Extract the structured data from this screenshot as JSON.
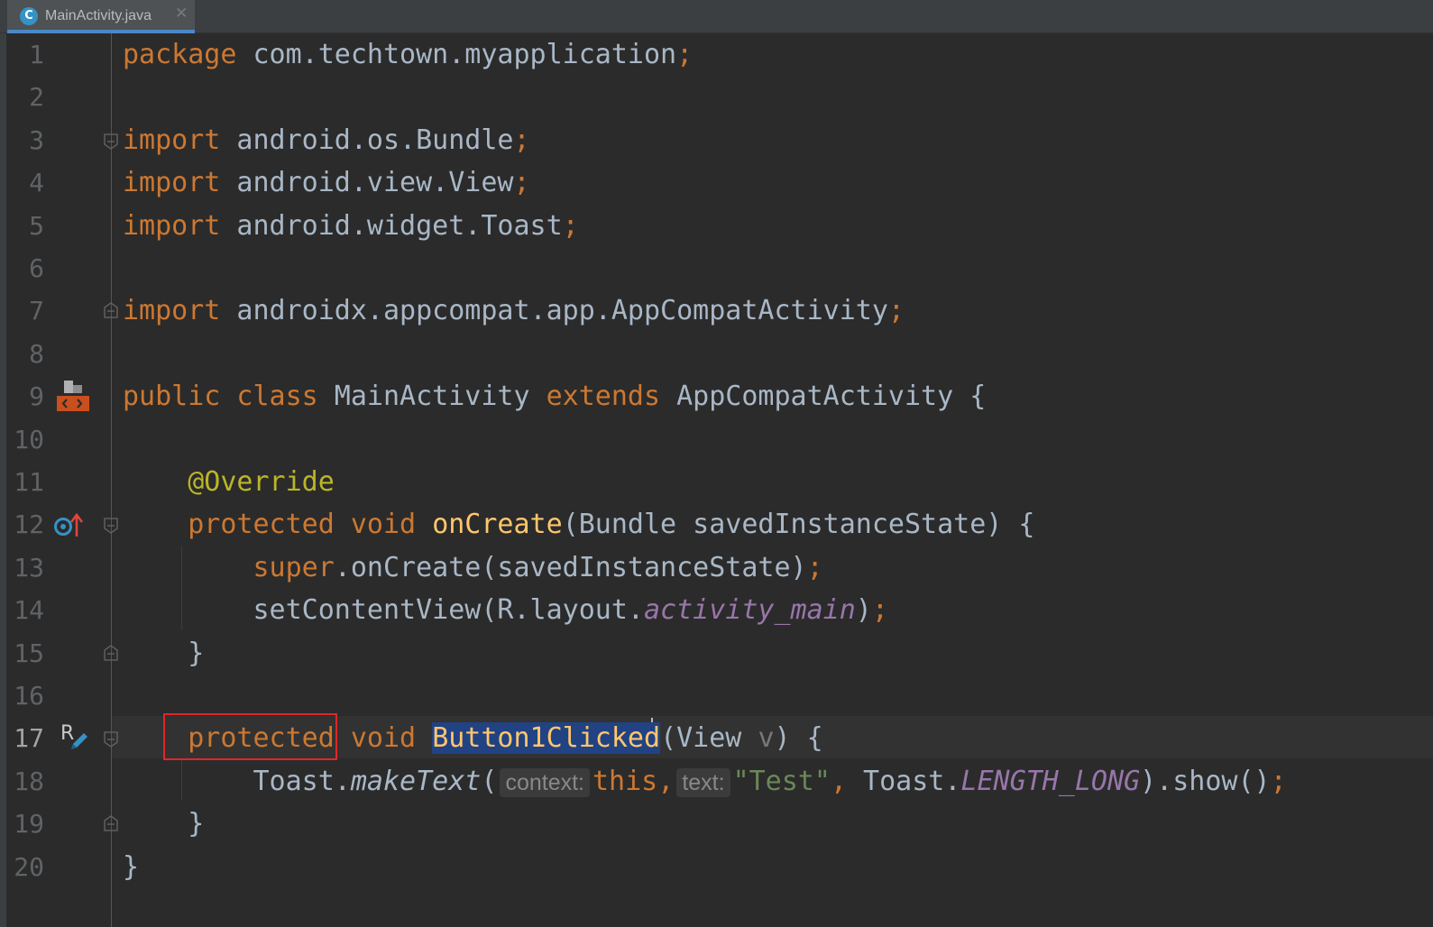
{
  "tab": {
    "icon_letter": "C",
    "label": "MainActivity.java",
    "close_glyph": "✕"
  },
  "editor": {
    "line_numbers": [
      "1",
      "2",
      "3",
      "4",
      "5",
      "6",
      "7",
      "8",
      "9",
      "10",
      "11",
      "12",
      "13",
      "14",
      "15",
      "16",
      "17",
      "18",
      "19",
      "20"
    ],
    "current_line": 17,
    "lines": [
      [
        "package",
        " com.techtown.myapplication",
        ";"
      ],
      [],
      [
        "import",
        " android.os.Bundle",
        ";"
      ],
      [
        "import",
        " android.view.View",
        ";"
      ],
      [
        "import",
        " android.widget.Toast",
        ";"
      ],
      [],
      [
        "import",
        " androidx.appcompat.app.AppCompatActivity",
        ";"
      ],
      [],
      [
        "public class",
        " MainActivity ",
        "extends",
        " AppCompatActivity {"
      ],
      [],
      [
        "    ",
        "@Override"
      ],
      [
        "    ",
        "protected void",
        " ",
        "onCreate",
        "(Bundle savedInstanceState) {"
      ],
      [
        "        ",
        "super",
        ".onCreate(savedInstanceState)",
        ";"
      ],
      [
        "        ",
        "setContentView(R.layout.",
        "activity_main",
        ")",
        ";"
      ],
      [
        "    }"
      ],
      [],
      [
        "    ",
        "protected",
        " ",
        "void",
        " ",
        "Button1Clicked",
        "(View ",
        "v",
        ") {"
      ],
      [
        "        ",
        "Toast.",
        "makeText",
        "(",
        "context:",
        "this,",
        "text:",
        "\"Test\"",
        ",",
        " Toast.",
        "LENGTH_LONG",
        ").show()",
        ";"
      ],
      [
        "    }"
      ],
      [
        "}"
      ]
    ]
  },
  "gutter_icons": {
    "line9": "class-layout-icon",
    "line12": "override-method-icon",
    "line17": "resource-edit-icon",
    "line17_letter": "R"
  },
  "colors": {
    "background": "#2b2b2b",
    "keyword": "#cc7832",
    "plain": "#a9b7c6",
    "annotation": "#bbb529",
    "method_decl": "#ffc66d",
    "static_field": "#9876aa",
    "string": "#6a8759",
    "selection": "#214283",
    "highlight_box": "#e0262a"
  }
}
